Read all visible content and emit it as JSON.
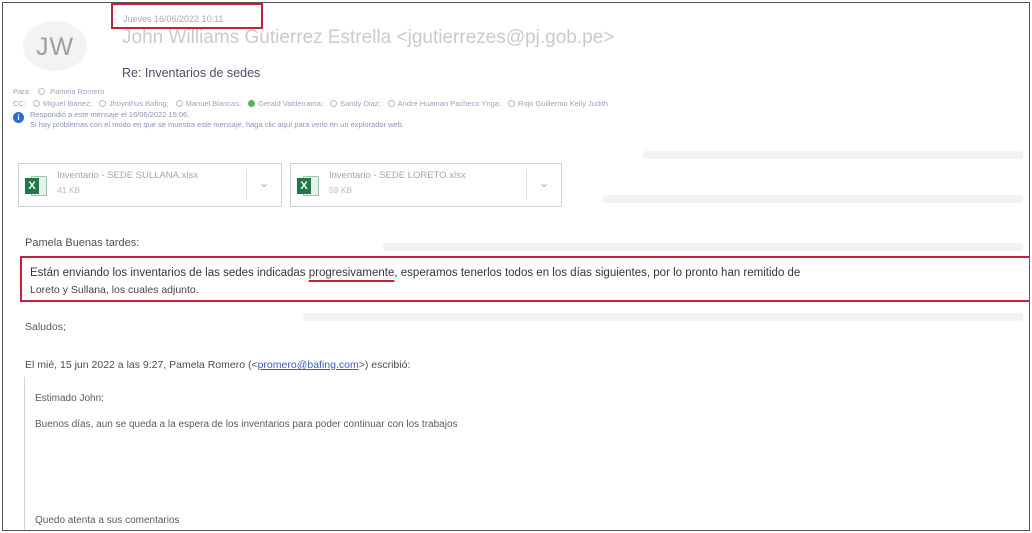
{
  "header": {
    "date": "Jueves 16/06/2022 10:11",
    "avatar_initials": "JW",
    "sender": "John Williams Gutierrez Estrella <jgutierrezes@pj.gob.pe>",
    "subject": "Re: Inventarios de sedes"
  },
  "recipients": {
    "to_label": "Para:",
    "to": [
      "Pamela Romero"
    ],
    "cc_label": "CC:",
    "cc": [
      {
        "name": "Miguel Ibanez",
        "status": "none"
      },
      {
        "name": "Jhoynthus Bafing",
        "status": "none"
      },
      {
        "name": "Manuel Blancas",
        "status": "none"
      },
      {
        "name": "Gerald Valderrama",
        "status": "green"
      },
      {
        "name": "Sandy Diaz",
        "status": "none"
      },
      {
        "name": "Andre Huaman Pacheco Ynga",
        "status": "none"
      },
      {
        "name": "Rojo Guillermo Kelly Judith",
        "status": "none"
      }
    ]
  },
  "info": {
    "line1": "Respondió a este mensaje el 16/06/2022 15:06.",
    "line2": "Si hay problemas con el modo en que se muestra este mensaje, haga clic aquí para verlo en un explorador web."
  },
  "attachments": [
    {
      "name": "Inventario - SEDE SULLANA.xlsx",
      "size": "41 KB",
      "icon": "excel-icon"
    },
    {
      "name": "Inventario - SEDE LORETO.xlsx",
      "size": "59 KB",
      "icon": "excel-icon"
    }
  ],
  "body": {
    "greeting": "Pamela Buenas tardes:",
    "p1_before": "Están enviando los inventarios de las sedes indicadas ",
    "p1_underlined": "progresivamente",
    "p1_after": ", esperamos tenerlos todos en los días siguientes, por lo pronto han remitido de",
    "p2": "Loreto y Sullana, los cuales adjunto.",
    "closing": "Saludos;"
  },
  "quoted": {
    "intro_before": "El mié, 15 jun 2022 a las 9:27, Pamela Romero (<",
    "intro_email": "promero@bafing.com",
    "intro_after": ">) escribió:",
    "line1": "Estimado John:",
    "line2": "Buenos días, aun se queda a la espera de los inventarios para poder continuar con los trabajos",
    "line3": "Quedo atenta a sus comentarios"
  },
  "colors": {
    "highlight_box": "#c0243a",
    "excel_green": "#1f7a44",
    "info_blue": "#2b6cd2",
    "link": "#3a5cc7"
  }
}
